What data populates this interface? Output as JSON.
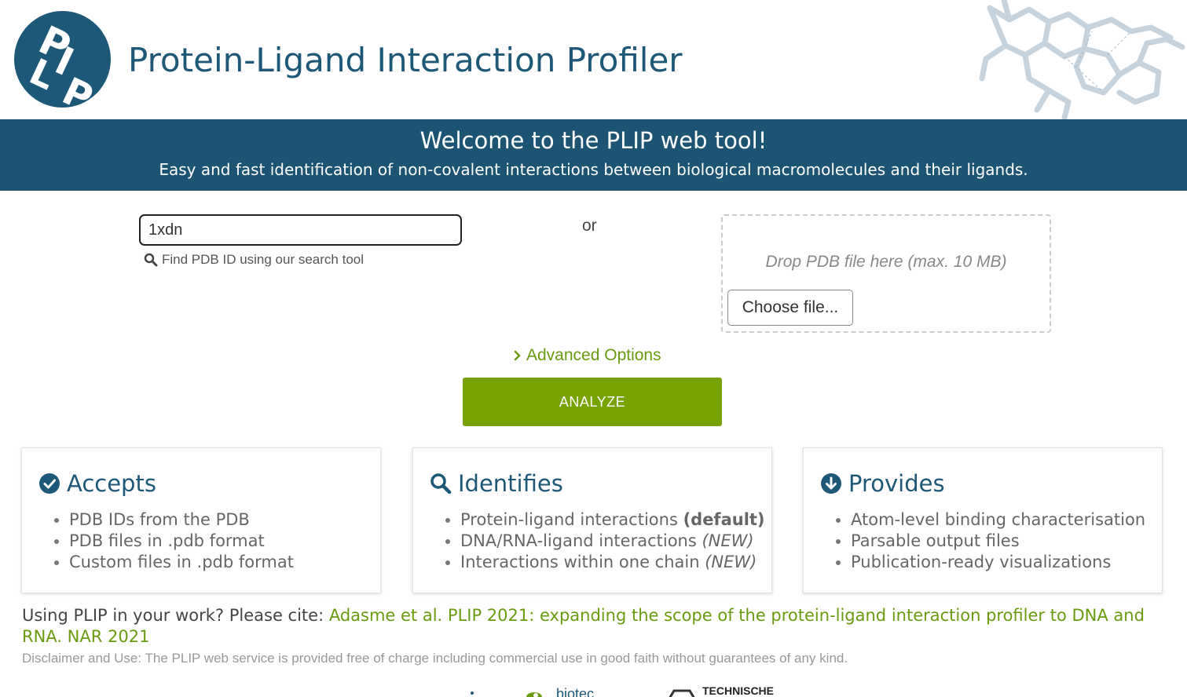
{
  "header": {
    "logo_text": "PLIP",
    "title": "Protein-Ligand Interaction Profiler"
  },
  "banner": {
    "title": "Welcome to the PLIP web tool!",
    "subtitle": "Easy and fast identification of non-covalent interactions between biological macromolecules and their ligands."
  },
  "form": {
    "pdb_id_value": "1xdn",
    "search_hint": "Find PDB ID using our search tool",
    "or_label": "or",
    "drop_text": "Drop PDB file here (max. 10 MB)",
    "choose_file_label": "Choose file...",
    "advanced_label": "Advanced Options",
    "analyze_label": "ANALYZE"
  },
  "cards": [
    {
      "title": "Accepts",
      "icon": "check-circle-icon",
      "items": [
        {
          "text": "PDB IDs from the PDB",
          "suffix": ""
        },
        {
          "text": "PDB files in .pdb format",
          "suffix": ""
        },
        {
          "text": "Custom files in .pdb format",
          "suffix": ""
        }
      ]
    },
    {
      "title": "Identifies",
      "icon": "search-icon",
      "items": [
        {
          "text": "Protein-ligand interactions ",
          "suffix": "(default)"
        },
        {
          "text": "DNA/RNA-ligand interactions ",
          "suffix": "(NEW)"
        },
        {
          "text": "Interactions within one chain ",
          "suffix": "(NEW)"
        }
      ]
    },
    {
      "title": "Provides",
      "icon": "arrow-down-circle-icon",
      "items": [
        {
          "text": "Atom-level binding characterisation",
          "suffix": ""
        },
        {
          "text": "Parsable output files",
          "suffix": ""
        },
        {
          "text": "Publication-ready visualizations",
          "suffix": ""
        }
      ]
    }
  ],
  "citation": {
    "prefix": "Using PLIP in your work? Please cite: ",
    "link_text": "Adasme et al. PLIP 2021: expanding the scope of the protein-ligand interaction profiler to DNA and RNA. NAR 2021"
  },
  "disclaimer": "Disclaimer and Use: The PLIP web service is provided free of charge including commercial use in good faith without guarantees of any kind.",
  "partners": [
    "biotec",
    "TECHNISCHE"
  ],
  "colors": {
    "primary": "#1d5473",
    "accent_green": "#76a300",
    "link_green": "#6a9a10"
  }
}
